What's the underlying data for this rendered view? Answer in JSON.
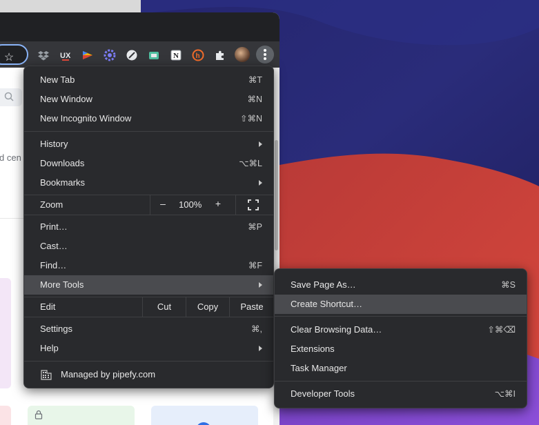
{
  "main_menu": {
    "items": [
      {
        "label": "New Tab",
        "shortcut": "⌘T"
      },
      {
        "label": "New Window",
        "shortcut": "⌘N"
      },
      {
        "label": "New Incognito Window",
        "shortcut": "⇧⌘N"
      },
      {
        "label": "History",
        "shortcut": ""
      },
      {
        "label": "Downloads",
        "shortcut": "⌥⌘L"
      },
      {
        "label": "Bookmarks",
        "shortcut": ""
      },
      {
        "label": "Print…",
        "shortcut": "⌘P"
      },
      {
        "label": "Cast…",
        "shortcut": ""
      },
      {
        "label": "Find…",
        "shortcut": "⌘F"
      },
      {
        "label": "More Tools",
        "shortcut": ""
      },
      {
        "label": "Settings",
        "shortcut": "⌘,"
      },
      {
        "label": "Help",
        "shortcut": ""
      }
    ],
    "zoom": {
      "label": "Zoom",
      "minus": "–",
      "value": "100%",
      "plus": "+"
    },
    "edit": {
      "label": "Edit",
      "cut": "Cut",
      "copy": "Copy",
      "paste": "Paste"
    },
    "managed": {
      "label": "Managed by pipefy.com"
    }
  },
  "sub_menu": {
    "items": [
      {
        "label": "Save Page As…",
        "shortcut": "⌘S"
      },
      {
        "label": "Create Shortcut…",
        "shortcut": ""
      },
      {
        "label": "Clear Browsing Data…",
        "shortcut": "⇧⌘⌫"
      },
      {
        "label": "Extensions",
        "shortcut": ""
      },
      {
        "label": "Task Manager",
        "shortcut": ""
      },
      {
        "label": "Developer Tools",
        "shortcut": "⌥⌘I"
      }
    ]
  },
  "page": {
    "partial_text": "d cen"
  },
  "toolbar": {
    "star_glyph": "☆"
  },
  "extension_icons": [
    "dropbox-icon",
    "ux-icon",
    "flag-extension-icon",
    "gear-extension-icon",
    "slash-circle-icon",
    "screen-capture-icon",
    "notion-icon",
    "honey-icon",
    "puzzle-extensions-icon"
  ],
  "colors": {
    "menu_bg": "#292a2d",
    "highlight": "#4a4b4f",
    "accent": "#8ab4f8"
  }
}
